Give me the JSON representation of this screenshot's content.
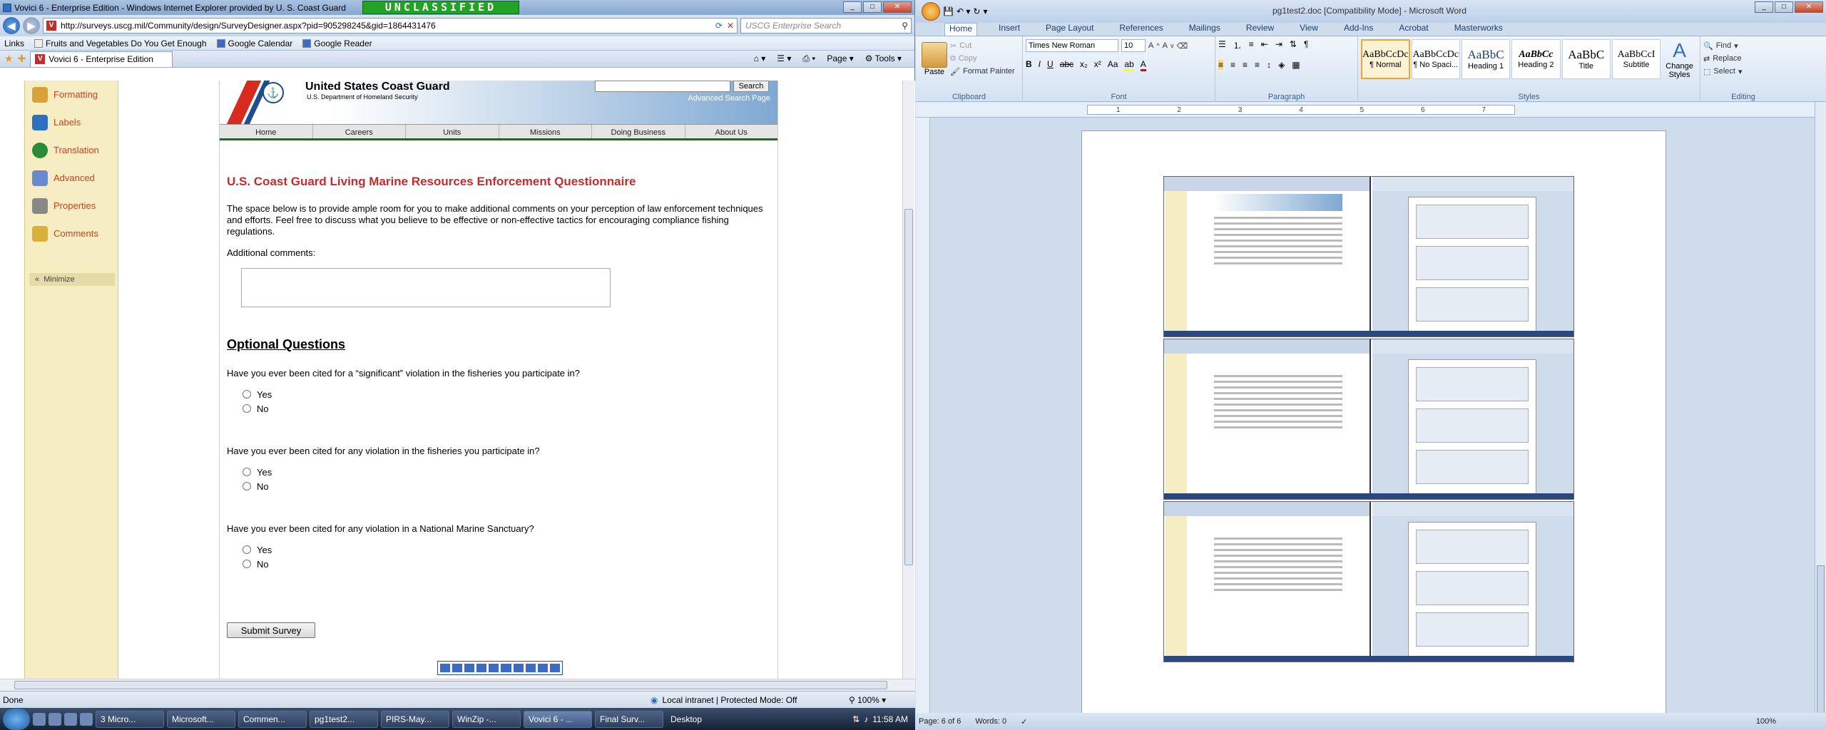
{
  "ie": {
    "title": "Vovici 6 - Enterprise Edition - Windows Internet Explorer provided by U. S. Coast Guard",
    "classification": "UNCLASSIFIED",
    "address": "http://surveys.uscg.mil/Community/design/SurveyDesigner.aspx?pid=905298245&gid=1864431476",
    "search_placeholder": "USCG Enterprise Search",
    "links_label": "Links",
    "links": [
      "Fruits and Vegetables Do You Get Enough",
      "Google Calendar",
      "Google Reader"
    ],
    "tab_label": "Vovici 6 - Enterprise Edition",
    "toolbar": {
      "page": "Page",
      "tools": "Tools"
    },
    "status_done": "Done",
    "status_zone": "Local intranet | Protected Mode: Off",
    "zoom": "100%"
  },
  "sidebar": {
    "items": [
      {
        "label": "Formatting",
        "color": "#d8a23a"
      },
      {
        "label": "Labels",
        "color": "#2f6fc0"
      },
      {
        "label": "Translation",
        "color": "#2a8a3a"
      },
      {
        "label": "Advanced",
        "color": "#6a8ad0"
      },
      {
        "label": "Properties",
        "color": "#888888"
      },
      {
        "label": "Comments",
        "color": "#d8b03a"
      }
    ],
    "minimize": "Minimize"
  },
  "banner": {
    "org": "United States Coast Guard",
    "dept": "U.S. Department of Homeland Security",
    "search_button": "Search",
    "advanced": "Advanced Search Page"
  },
  "topnav": [
    "Home",
    "Careers",
    "Units",
    "Missions",
    "Doing Business",
    "About Us"
  ],
  "survey": {
    "title": "U.S. Coast Guard Living Marine Resources Enforcement Questionnaire",
    "intro": "The space below is to provide ample room for you to make additional comments on your perception of law enforcement techniques and efforts. Feel free to discuss what you believe to be effective or non-effective tactics for encouraging compliance fishing regulations.",
    "additional_label": "Additional comments:",
    "optional_heading": "Optional Questions",
    "questions": [
      {
        "text": "Have you ever been cited for a “significant” violation in the fisheries you participate in?",
        "options": [
          "Yes",
          "No"
        ]
      },
      {
        "text": "Have you ever been cited for any violation in the fisheries you participate in?",
        "options": [
          "Yes",
          "No"
        ]
      },
      {
        "text": "Have you ever been cited for any violation in a National Marine Sanctuary?",
        "options": [
          "Yes",
          "No"
        ]
      }
    ],
    "submit": "Submit Survey",
    "progress_segments": 10
  },
  "word": {
    "title": "pg1test2.doc [Compatibility Mode] - Microsoft Word",
    "tabs": [
      "Home",
      "Insert",
      "Page Layout",
      "References",
      "Mailings",
      "Review",
      "View",
      "Add-Ins",
      "Acrobat",
      "Masterworks"
    ],
    "clipboard": {
      "paste": "Paste",
      "cut": "Cut",
      "copy": "Copy",
      "format_painter": "Format Painter",
      "label": "Clipboard"
    },
    "font": {
      "name": "Times New Roman",
      "size": "10",
      "label": "Font"
    },
    "paragraph_label": "Paragraph",
    "styles": [
      {
        "sample": "AaBbCcDc",
        "name": "¶ Normal"
      },
      {
        "sample": "AaBbCcDc",
        "name": "¶ No Spaci..."
      },
      {
        "sample": "AaBbC",
        "name": "Heading 1"
      },
      {
        "sample": "AaBbCc",
        "name": "Heading 2"
      },
      {
        "sample": "AaBbC",
        "name": "Title"
      },
      {
        "sample": "AaBbCcI",
        "name": "Subtitle"
      }
    ],
    "styles_label": "Styles",
    "change_styles": "Change Styles",
    "editing": {
      "find": "Find",
      "replace": "Replace",
      "select": "Select",
      "label": "Editing"
    },
    "status": {
      "page": "Page: 6 of 6",
      "words": "Words: 0",
      "zoom": "100%"
    }
  },
  "taskbar": {
    "items": [
      "3 Micro...",
      "Microsoft...",
      "Commen...",
      "pg1test2...",
      "PIRS-May...",
      "WinZip -...",
      "Vovici 6 - ...",
      "Final Surv..."
    ],
    "desktop": "Desktop",
    "time": "11:58 AM"
  }
}
